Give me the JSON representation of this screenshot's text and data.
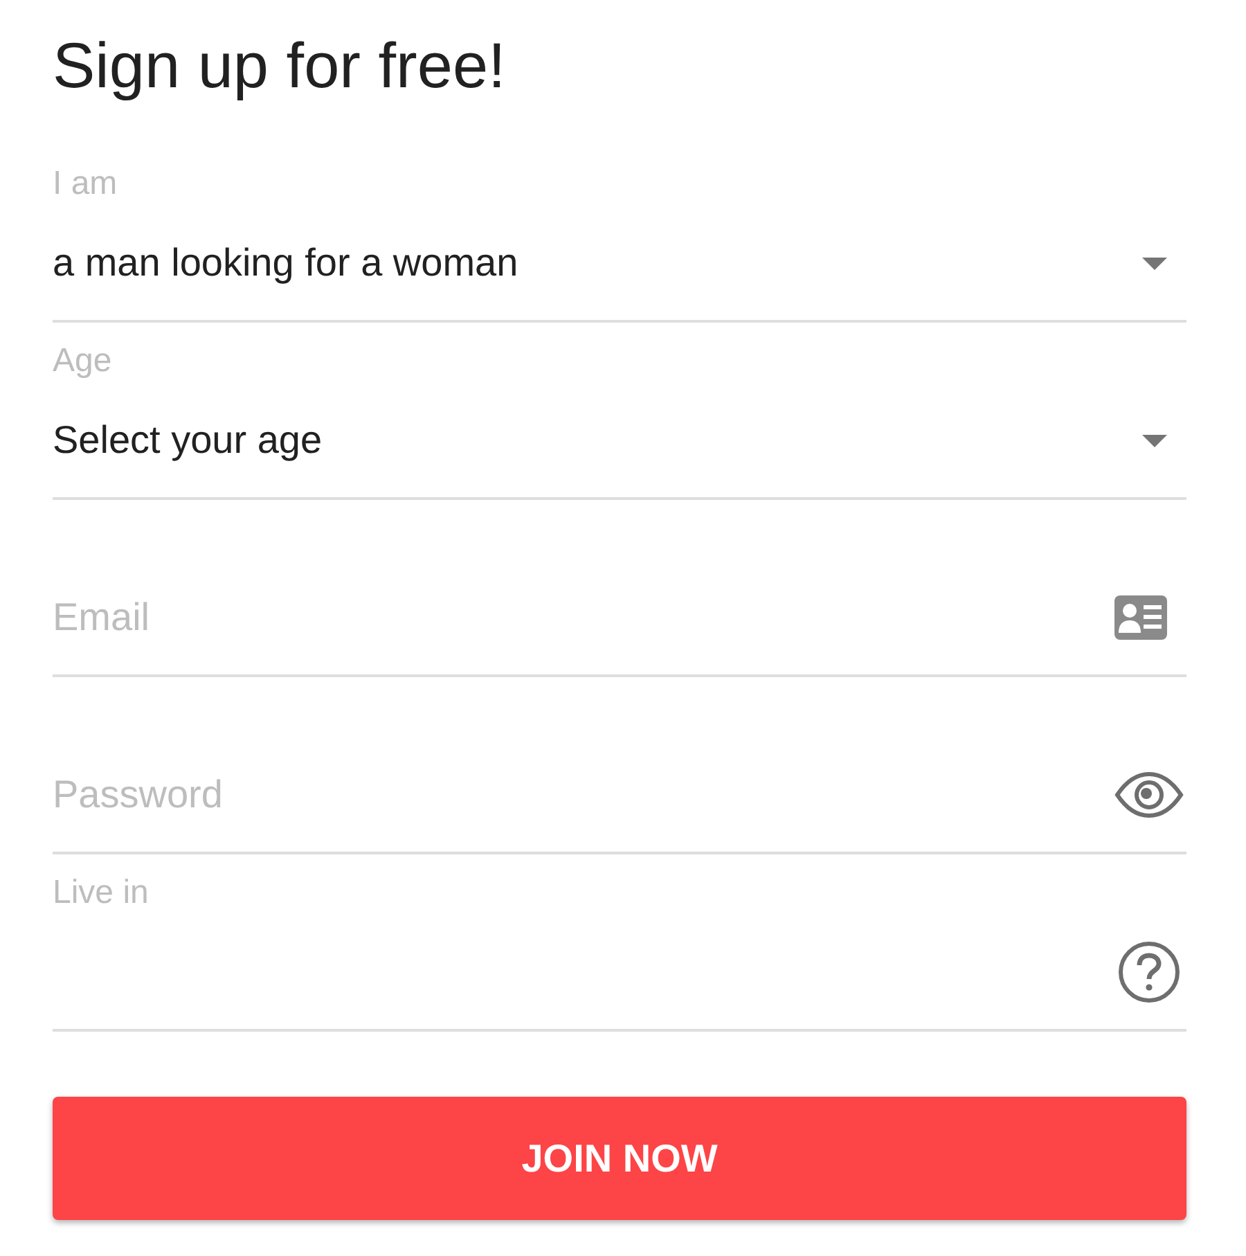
{
  "title": "Sign up for free!",
  "fields": [
    {
      "kind": "select",
      "label": "I am",
      "value": "a man looking for a woman"
    },
    {
      "kind": "select",
      "label": "Age",
      "value": "Select your age"
    },
    {
      "kind": "email",
      "placeholder": "Email"
    },
    {
      "kind": "password",
      "placeholder": "Password"
    },
    {
      "kind": "place",
      "label": "Live in"
    }
  ],
  "submit": "JOIN NOW"
}
